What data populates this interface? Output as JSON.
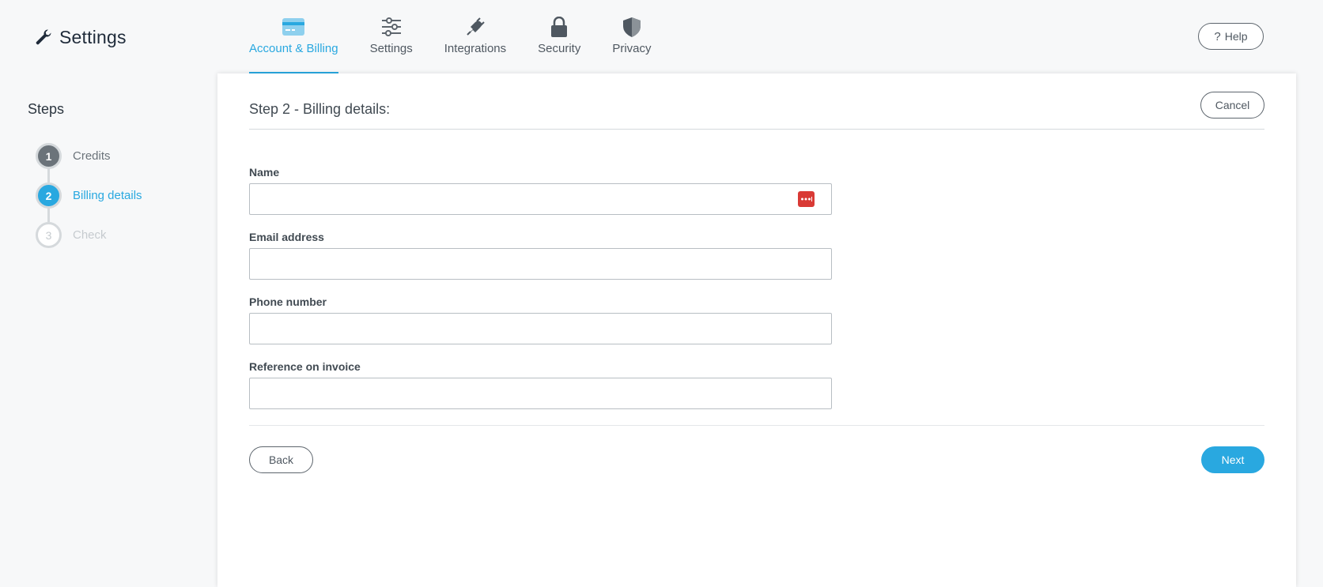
{
  "app": {
    "title": "Settings",
    "icon": "wrench-icon"
  },
  "nav": {
    "tabs": [
      {
        "label": "Account & Billing",
        "icon": "credit-card-icon",
        "active": true
      },
      {
        "label": "Settings",
        "icon": "sliders-icon",
        "active": false
      },
      {
        "label": "Integrations",
        "icon": "plug-icon",
        "active": false
      },
      {
        "label": "Security",
        "icon": "lock-icon",
        "active": false
      },
      {
        "label": "Privacy",
        "icon": "shield-icon",
        "active": false
      }
    ]
  },
  "help": {
    "label": "Help",
    "icon": "question-icon"
  },
  "steps": {
    "title": "Steps",
    "items": [
      {
        "number": "1",
        "label": "Credits",
        "state": "done"
      },
      {
        "number": "2",
        "label": "Billing details",
        "state": "current"
      },
      {
        "number": "3",
        "label": "Check",
        "state": "todo"
      }
    ]
  },
  "card": {
    "title": "Step 2 - Billing details:",
    "cancel_label": "Cancel"
  },
  "form": {
    "fields": [
      {
        "label": "Name",
        "value": "",
        "placeholder": ""
      },
      {
        "label": "Email address",
        "value": "",
        "placeholder": ""
      },
      {
        "label": "Phone number",
        "value": "",
        "placeholder": ""
      },
      {
        "label": "Reference on invoice",
        "value": "",
        "placeholder": ""
      }
    ]
  },
  "footer": {
    "back_label": "Back",
    "next_label": "Next"
  },
  "colors": {
    "accent": "#29a8e0",
    "text": "#414a52",
    "password_manager": "#d93a35"
  }
}
